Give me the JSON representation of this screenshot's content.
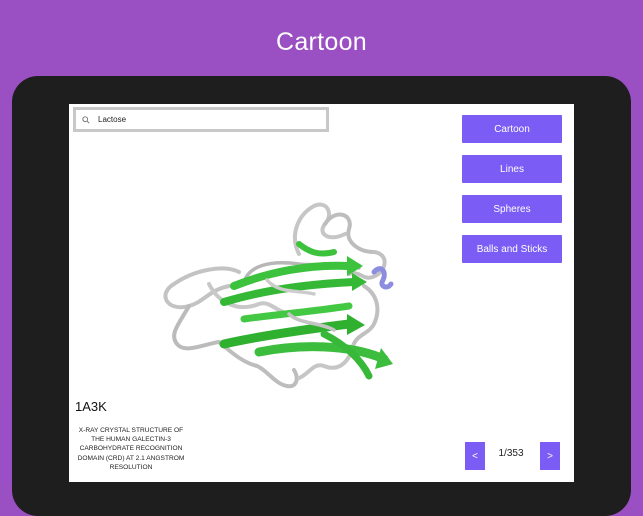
{
  "header": {
    "title": "Cartoon"
  },
  "search": {
    "value": "Lactose",
    "icon": "search-icon"
  },
  "modes": {
    "cartoon": "Cartoon",
    "lines": "Lines",
    "spheres": "Spheres",
    "balls_and_sticks": "Balls and Sticks"
  },
  "structure": {
    "id": "1A3K",
    "description": "X-RAY CRYSTAL STRUCTURE OF THE HUMAN GALECTIN-3 CARBOHYDRATE RECOGNITION DOMAIN (CRD) AT 2.1 ANGSTROM RESOLUTION"
  },
  "pagination": {
    "prev": "<",
    "next": ">",
    "counter": "1/353"
  },
  "colors": {
    "background": "#9a4fc4",
    "accent": "#7b5cf5",
    "sheet": "#3cc23c",
    "coil": "#c8c8c8",
    "helix": "#8888dd"
  }
}
